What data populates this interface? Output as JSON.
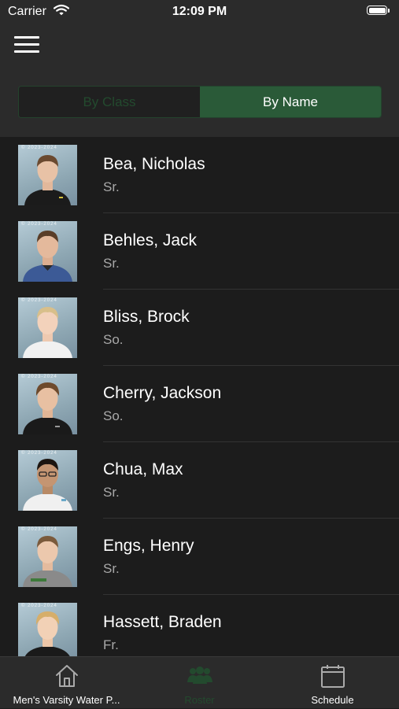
{
  "status_bar": {
    "carrier": "Carrier",
    "time": "12:09 PM"
  },
  "segment": {
    "by_class_label": "By Class",
    "by_name_label": "By Name",
    "selected": "By Name"
  },
  "roster": [
    {
      "name": "Bea, Nicholas",
      "class_year": "Sr.",
      "photo_year": "© 2023-2024"
    },
    {
      "name": "Behles, Jack",
      "class_year": "Sr.",
      "photo_year": "© 2023-2024"
    },
    {
      "name": "Bliss, Brock",
      "class_year": "So.",
      "photo_year": "© 2023-2024"
    },
    {
      "name": "Cherry, Jackson",
      "class_year": "So.",
      "photo_year": "© 2023-2024"
    },
    {
      "name": "Chua, Max",
      "class_year": "Sr.",
      "photo_year": "© 2023-2024"
    },
    {
      "name": "Engs, Henry",
      "class_year": "Sr.",
      "photo_year": "© 2023-2024"
    },
    {
      "name": "Hassett, Braden",
      "class_year": "Fr.",
      "photo_year": "© 2023-2024"
    }
  ],
  "tab_bar": {
    "home_label": "Men's Varsity Water P...",
    "roster_label": "Roster",
    "schedule_label": "Schedule",
    "selected": "Roster"
  },
  "colors": {
    "accent_green": "#2a5a38",
    "dim_green": "#234a2e",
    "background": "#1c1c1c",
    "bar": "#2b2b2b"
  }
}
